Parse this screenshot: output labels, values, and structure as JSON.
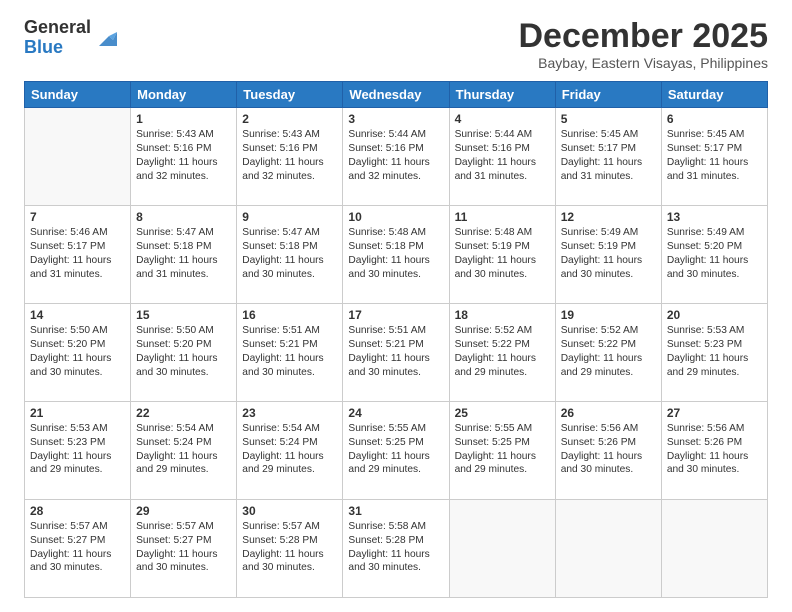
{
  "header": {
    "logo_general": "General",
    "logo_blue": "Blue",
    "month": "December 2025",
    "location": "Baybay, Eastern Visayas, Philippines"
  },
  "days_of_week": [
    "Sunday",
    "Monday",
    "Tuesday",
    "Wednesday",
    "Thursday",
    "Friday",
    "Saturday"
  ],
  "weeks": [
    [
      {
        "num": "",
        "text": ""
      },
      {
        "num": "1",
        "text": "Sunrise: 5:43 AM\nSunset: 5:16 PM\nDaylight: 11 hours\nand 32 minutes."
      },
      {
        "num": "2",
        "text": "Sunrise: 5:43 AM\nSunset: 5:16 PM\nDaylight: 11 hours\nand 32 minutes."
      },
      {
        "num": "3",
        "text": "Sunrise: 5:44 AM\nSunset: 5:16 PM\nDaylight: 11 hours\nand 32 minutes."
      },
      {
        "num": "4",
        "text": "Sunrise: 5:44 AM\nSunset: 5:16 PM\nDaylight: 11 hours\nand 31 minutes."
      },
      {
        "num": "5",
        "text": "Sunrise: 5:45 AM\nSunset: 5:17 PM\nDaylight: 11 hours\nand 31 minutes."
      },
      {
        "num": "6",
        "text": "Sunrise: 5:45 AM\nSunset: 5:17 PM\nDaylight: 11 hours\nand 31 minutes."
      }
    ],
    [
      {
        "num": "7",
        "text": "Sunrise: 5:46 AM\nSunset: 5:17 PM\nDaylight: 11 hours\nand 31 minutes."
      },
      {
        "num": "8",
        "text": "Sunrise: 5:47 AM\nSunset: 5:18 PM\nDaylight: 11 hours\nand 31 minutes."
      },
      {
        "num": "9",
        "text": "Sunrise: 5:47 AM\nSunset: 5:18 PM\nDaylight: 11 hours\nand 30 minutes."
      },
      {
        "num": "10",
        "text": "Sunrise: 5:48 AM\nSunset: 5:18 PM\nDaylight: 11 hours\nand 30 minutes."
      },
      {
        "num": "11",
        "text": "Sunrise: 5:48 AM\nSunset: 5:19 PM\nDaylight: 11 hours\nand 30 minutes."
      },
      {
        "num": "12",
        "text": "Sunrise: 5:49 AM\nSunset: 5:19 PM\nDaylight: 11 hours\nand 30 minutes."
      },
      {
        "num": "13",
        "text": "Sunrise: 5:49 AM\nSunset: 5:20 PM\nDaylight: 11 hours\nand 30 minutes."
      }
    ],
    [
      {
        "num": "14",
        "text": "Sunrise: 5:50 AM\nSunset: 5:20 PM\nDaylight: 11 hours\nand 30 minutes."
      },
      {
        "num": "15",
        "text": "Sunrise: 5:50 AM\nSunset: 5:20 PM\nDaylight: 11 hours\nand 30 minutes."
      },
      {
        "num": "16",
        "text": "Sunrise: 5:51 AM\nSunset: 5:21 PM\nDaylight: 11 hours\nand 30 minutes."
      },
      {
        "num": "17",
        "text": "Sunrise: 5:51 AM\nSunset: 5:21 PM\nDaylight: 11 hours\nand 30 minutes."
      },
      {
        "num": "18",
        "text": "Sunrise: 5:52 AM\nSunset: 5:22 PM\nDaylight: 11 hours\nand 29 minutes."
      },
      {
        "num": "19",
        "text": "Sunrise: 5:52 AM\nSunset: 5:22 PM\nDaylight: 11 hours\nand 29 minutes."
      },
      {
        "num": "20",
        "text": "Sunrise: 5:53 AM\nSunset: 5:23 PM\nDaylight: 11 hours\nand 29 minutes."
      }
    ],
    [
      {
        "num": "21",
        "text": "Sunrise: 5:53 AM\nSunset: 5:23 PM\nDaylight: 11 hours\nand 29 minutes."
      },
      {
        "num": "22",
        "text": "Sunrise: 5:54 AM\nSunset: 5:24 PM\nDaylight: 11 hours\nand 29 minutes."
      },
      {
        "num": "23",
        "text": "Sunrise: 5:54 AM\nSunset: 5:24 PM\nDaylight: 11 hours\nand 29 minutes."
      },
      {
        "num": "24",
        "text": "Sunrise: 5:55 AM\nSunset: 5:25 PM\nDaylight: 11 hours\nand 29 minutes."
      },
      {
        "num": "25",
        "text": "Sunrise: 5:55 AM\nSunset: 5:25 PM\nDaylight: 11 hours\nand 29 minutes."
      },
      {
        "num": "26",
        "text": "Sunrise: 5:56 AM\nSunset: 5:26 PM\nDaylight: 11 hours\nand 30 minutes."
      },
      {
        "num": "27",
        "text": "Sunrise: 5:56 AM\nSunset: 5:26 PM\nDaylight: 11 hours\nand 30 minutes."
      }
    ],
    [
      {
        "num": "28",
        "text": "Sunrise: 5:57 AM\nSunset: 5:27 PM\nDaylight: 11 hours\nand 30 minutes."
      },
      {
        "num": "29",
        "text": "Sunrise: 5:57 AM\nSunset: 5:27 PM\nDaylight: 11 hours\nand 30 minutes."
      },
      {
        "num": "30",
        "text": "Sunrise: 5:57 AM\nSunset: 5:28 PM\nDaylight: 11 hours\nand 30 minutes."
      },
      {
        "num": "31",
        "text": "Sunrise: 5:58 AM\nSunset: 5:28 PM\nDaylight: 11 hours\nand 30 minutes."
      },
      {
        "num": "",
        "text": ""
      },
      {
        "num": "",
        "text": ""
      },
      {
        "num": "",
        "text": ""
      }
    ]
  ]
}
